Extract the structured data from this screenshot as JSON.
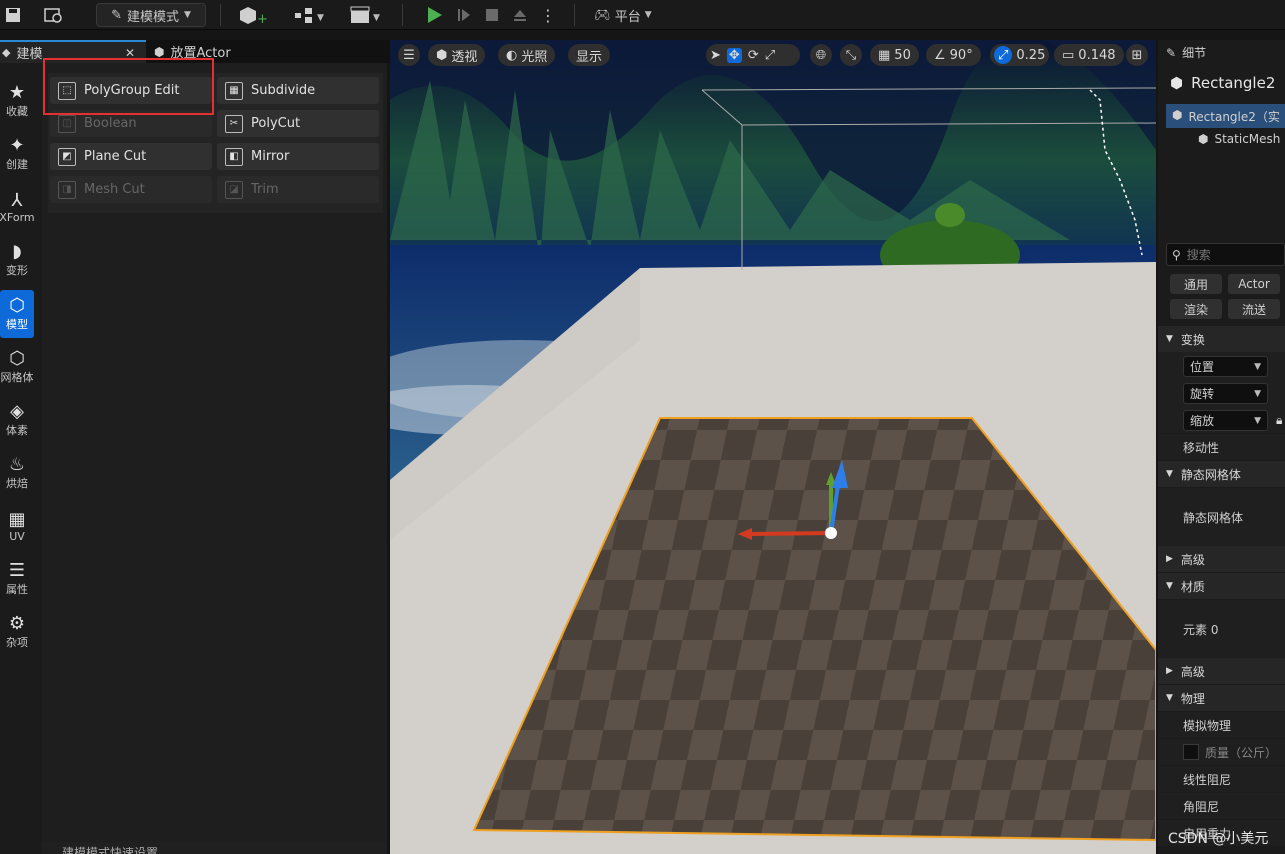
{
  "toolbar": {
    "mode_label": "建模模式",
    "platform_label": "平台"
  },
  "tabs": [
    {
      "label": "建模"
    },
    {
      "label": "放置Actor"
    }
  ],
  "nav": [
    {
      "label": "收藏",
      "icon": "star-icon"
    },
    {
      "label": "创建",
      "icon": "create-icon"
    },
    {
      "label": "XForm",
      "icon": "xform-icon"
    },
    {
      "label": "变形",
      "icon": "deform-icon"
    },
    {
      "label": "模型",
      "icon": "model-icon"
    },
    {
      "label": "网格体",
      "icon": "mesh-icon"
    },
    {
      "label": "体素",
      "icon": "voxel-icon"
    },
    {
      "label": "烘焙",
      "icon": "bake-icon"
    },
    {
      "label": "UV",
      "icon": "uv-icon"
    },
    {
      "label": "属性",
      "icon": "attributes-icon"
    },
    {
      "label": "杂项",
      "icon": "misc-icon"
    }
  ],
  "tools": [
    {
      "label": "PolyGroup Edit",
      "enabled": true
    },
    {
      "label": "Subdivide",
      "enabled": true
    },
    {
      "label": "Boolean",
      "enabled": false
    },
    {
      "label": "PolyCut",
      "enabled": true
    },
    {
      "label": "Plane Cut",
      "enabled": true
    },
    {
      "label": "Mirror",
      "enabled": true
    },
    {
      "label": "Mesh Cut",
      "enabled": false
    },
    {
      "label": "Trim",
      "enabled": false
    }
  ],
  "bottom_hint": "建模模式快速设置",
  "viewport": {
    "perspective_label": "透视",
    "lighting_label": "光照",
    "show_label": "显示",
    "grid_snap": "50",
    "rotation_snap": "90°",
    "scale_snap": "0.25",
    "camera_speed": "0.148"
  },
  "details": {
    "tab_label": "细节",
    "actor_name": "Rectangle2",
    "tree_root": "Rectangle2（实",
    "tree_child": "StaticMesh",
    "search_placeholder": "搜索",
    "filters": [
      "通用",
      "Actor",
      "渲染",
      "流送"
    ],
    "sections": {
      "transform": "变换",
      "static_mesh": "静态网格体",
      "advanced1": "高级",
      "material": "材质",
      "advanced2": "高级",
      "physics": "物理"
    },
    "props": {
      "location": "位置",
      "rotation": "旋转",
      "scale": "缩放",
      "mobility": "移动性",
      "static_mesh": "静态网格体",
      "element0": "元素 0",
      "simulate_physics": "模拟物理",
      "mass": "质量（公斤）",
      "linear_damping": "线性阻尼",
      "angular_damping": "角阻尼",
      "enable_gravity": "启用重力"
    }
  },
  "watermark": "CSDN @小美元"
}
